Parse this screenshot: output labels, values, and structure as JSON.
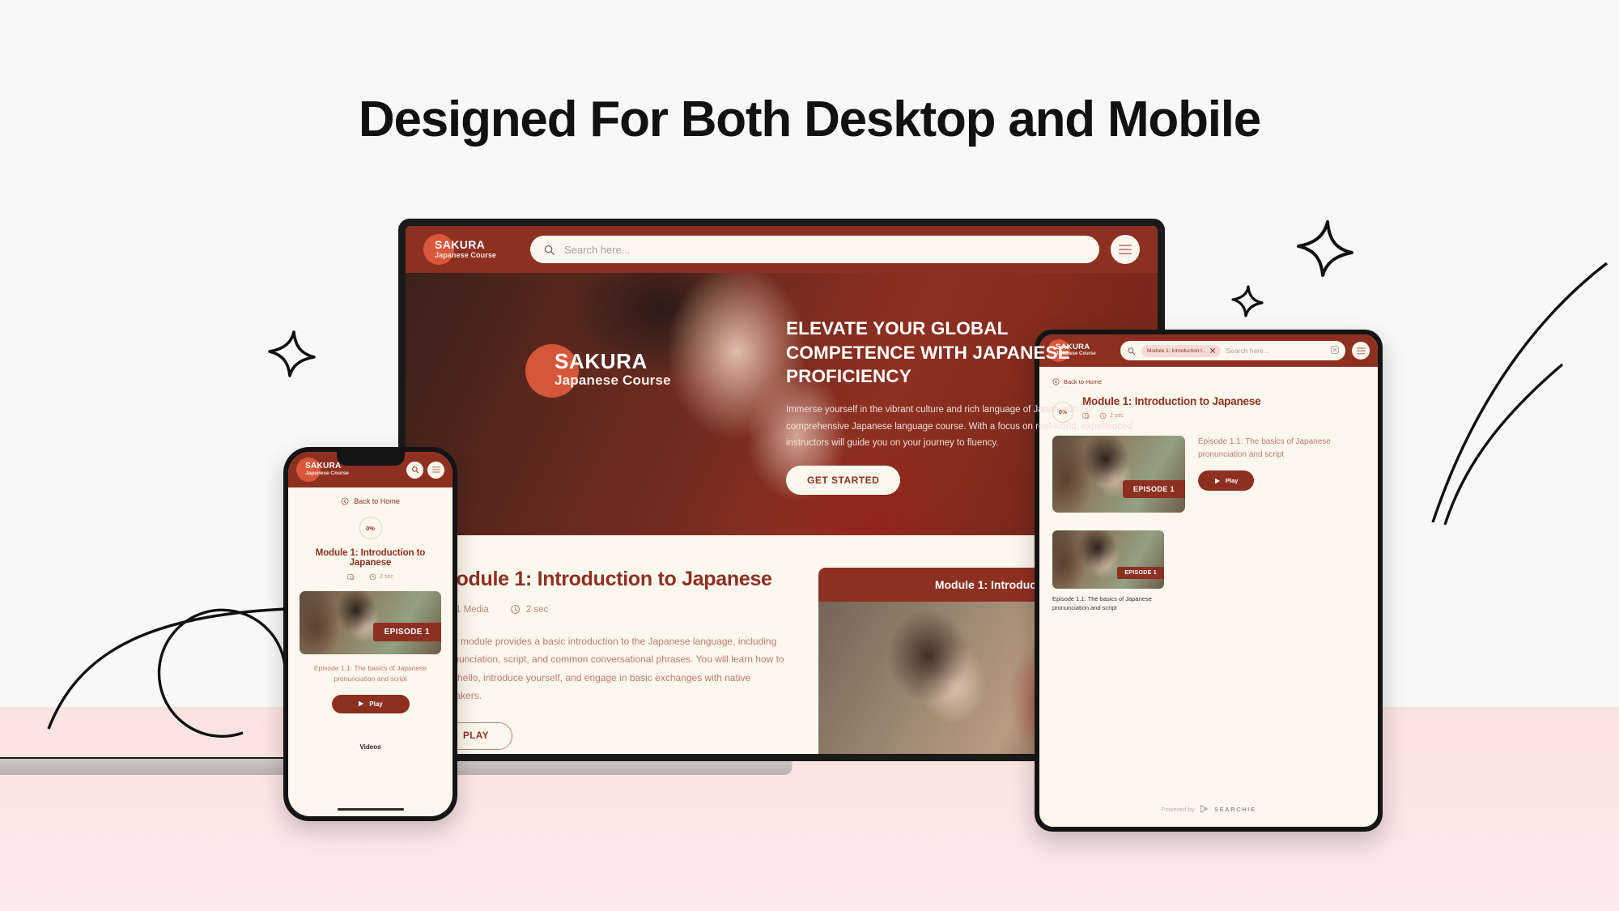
{
  "page": {
    "headline": "Designed For Both Desktop and Mobile",
    "colors": {
      "brand_red": "#8E3021",
      "accent_orange": "#D9573B",
      "cream": "#FDF8EE",
      "bg_top": "#F8F8F8",
      "bg_bottom_pink": "#FBE3E1",
      "muted_rose": "#C07A6C"
    }
  },
  "brand": {
    "name": "SAKURA",
    "subtitle": "Japanese Course"
  },
  "desktop": {
    "search": {
      "placeholder": "Search here..."
    },
    "menu_icon": "hamburger-menu-icon",
    "search_icon": "search-icon",
    "hero": {
      "logo_name": "SAKURA",
      "logo_subtitle": "Japanese Course",
      "heading": "ELEVATE YOUR GLOBAL COMPETENCE WITH JAPANESE PROFICIENCY",
      "paragraph": "Immerse yourself in the vibrant culture and rich language of Japan with our comprehensive Japanese language course. With a focus on real-world, experienced instructors will guide you on your journey to fluency.",
      "cta_label": "GET STARTED"
    },
    "module": {
      "title": "Module 1: Introduction to Japanese",
      "media_count": "1 Media",
      "duration": "2 sec",
      "description": "This module provides a basic introduction to the Japanese language, including pronunciation, script, and common conversational phrases. You will learn how to say hello, introduce yourself, and engage in basic exchanges with native speakers.",
      "play_label": "PLAY"
    },
    "video_card": {
      "header": "Module 1: Introduction To Japan"
    }
  },
  "phone": {
    "search_icon": "search-icon",
    "menu_icon": "hamburger-menu-icon",
    "back_label": "Back to Home",
    "progress": "0%",
    "module_title": "Module 1: Introduction to Japanese",
    "media_count": "",
    "duration": "2 sec",
    "episode_badge": "EPISODE 1",
    "episode_title": "Episode 1.1: The basics of Japanese pronunciation and script",
    "play_label": "Play",
    "videos_label": "Videos"
  },
  "tablet": {
    "search_chip": "Module 1: Introduction t..",
    "chip_close_icon": "close-icon",
    "search_placeholder": "Search here...",
    "clear_icon": "clear-search-icon",
    "menu_icon": "hamburger-menu-icon",
    "back_label": "Back to Home",
    "progress": "0%",
    "module_title": "Module 1: Introduction to Japanese",
    "duration": "2 sec",
    "card1": {
      "badge": "EPISODE 1",
      "title": "Episode 1.1: The basics of Japanese pronunciation and script",
      "play_label": "Play"
    },
    "card2": {
      "badge": "EPISODE 1",
      "title": "Episode 1.1: The basics of Japanese pronunciation and script"
    },
    "footer": {
      "powered_by": "Powered by",
      "provider": "SEARCHIE"
    }
  }
}
